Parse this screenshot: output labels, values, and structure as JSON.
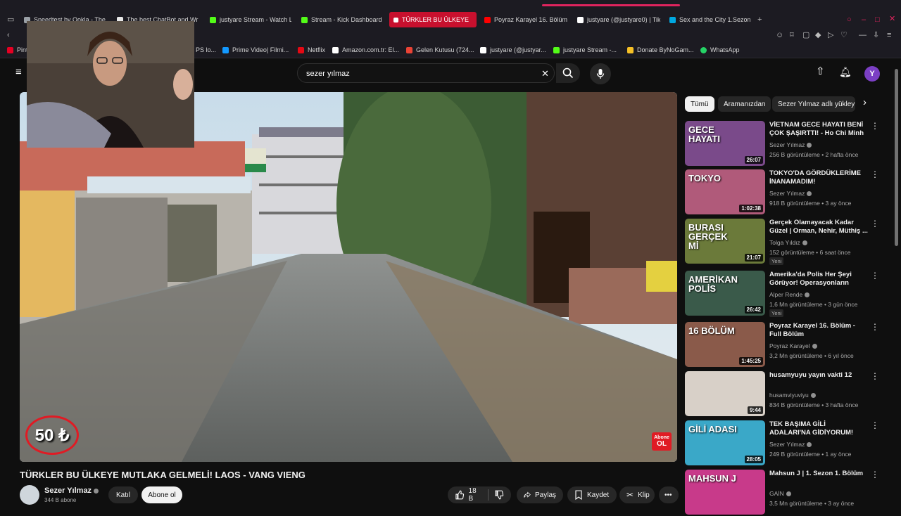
{
  "browser": {
    "tabs": [
      {
        "label": "Speedtest by Ookla - The",
        "color": "#9aa0a6"
      },
      {
        "label": "The best ChatBot and Wr",
        "color": "#e8e8e8"
      },
      {
        "label": "justyare Stream - Watch L",
        "color": "#53fc18"
      },
      {
        "label": "Stream - Kick Dashboard",
        "color": "#53fc18"
      },
      {
        "label": "TÜRKLER BU ÜLKEYE",
        "color": "#ff0000"
      },
      {
        "label": "Poyraz Karayel 16. Bölüm",
        "color": "#ff0000"
      },
      {
        "label": "justyare (@justyare0) | Tik",
        "color": "#ffffff"
      },
      {
        "label": "Sex and the City 1.Sezon",
        "color": "#00a8e1"
      }
    ],
    "bookmarks": [
      {
        "label": "Pint",
        "color": "#e60023"
      },
      {
        "label": "PS lo...",
        "color": "#0070d1"
      },
      {
        "label": "Prime Video| Filmi...",
        "color": "#1399ff"
      },
      {
        "label": "Netflix",
        "color": "#e50914"
      },
      {
        "label": "Amazon.com.tr: El...",
        "color": "#ffffff"
      },
      {
        "label": "Gelen Kutusu (724...",
        "color": "#ea4335"
      },
      {
        "label": "justyare (@justyar...",
        "color": "#ffffff"
      },
      {
        "label": "justyare Stream -...",
        "color": "#53fc18"
      },
      {
        "label": "Donate ByNoGam...",
        "color": "#f6c026"
      },
      {
        "label": "WhatsApp",
        "color": "#25d366"
      }
    ]
  },
  "youtube": {
    "search_value": "sezer yılmaz",
    "avatar_letter": "Y",
    "video_badge": "50 ₺",
    "abone_badge_top": "Abone",
    "abone_badge_bottom": "OL",
    "video_title": "TÜRKLER BU ÜLKEYE MUTLAKA GELMELİ! LAOS - VANG VIENG",
    "channel": "Sezer Yılmaz",
    "subscribers": "344 B abone",
    "join_label": "Katıl",
    "subscribe_label": "Abone ol",
    "likes": "18 B",
    "share_label": "Paylaş",
    "save_label": "Kaydet",
    "clip_label": "Klip",
    "chips": [
      "Tümü",
      "Aramanızdan",
      "Sezer Yılmaz adlı yükley"
    ],
    "related": [
      {
        "title": "VİETNAM GECE HAYATI BENİ ÇOK ŞAŞIRTTI! - Ho Chi Minh",
        "channel": "Sezer Yılmaz",
        "meta": "256 B görüntüleme • 2 hafta önce",
        "duration": "26:07",
        "color": "#7a4a8a",
        "overlay": "GECE HAYATI",
        "new": ""
      },
      {
        "title": "TOKYO'DA GÖRDÜKLERİME İNANAMADIM!",
        "channel": "Sezer Yılmaz",
        "meta": "918 B görüntüleme • 3 ay önce",
        "duration": "1:02:38",
        "color": "#b05a7a",
        "overlay": "TOKYO",
        "new": ""
      },
      {
        "title": "Gerçek Olamayacak Kadar Güzel | Orman, Nehir, Müthiş ...",
        "channel": "Tolga Yıldız",
        "meta": "152 görüntüleme • 6 saat önce",
        "duration": "21:07",
        "color": "#6b7a3a",
        "overlay": "BURASI GERÇEK Mİ",
        "new": "Yeni"
      },
      {
        "title": "Amerika'da Polis Her Şeyi Görüyor! Operasyonların Perde...",
        "channel": "Alper Rende",
        "meta": "1,6 Mn görüntüleme • 3 gün önce",
        "duration": "26:42",
        "color": "#3a5a4a",
        "overlay": "AMERİKAN POLİS",
        "new": "Yeni"
      },
      {
        "title": "Poyraz Karayel 16. Bölüm - Full Bölüm",
        "channel": "Poyraz Karayel",
        "meta": "3,2 Mn görüntüleme • 6 yıl önce",
        "duration": "1:45:25",
        "color": "#8a5a4a",
        "overlay": "16 BÖLÜM",
        "new": ""
      },
      {
        "title": "husamyuyu yayın vakti 12",
        "channel": "husamviyuviyu",
        "meta": "834 B görüntüleme • 3 hafta önce",
        "duration": "9:44",
        "color": "#d8d0c8",
        "overlay": "",
        "new": ""
      },
      {
        "title": "TEK BAŞIMA GİLİ ADALARI'NA GİDİYORUM!",
        "channel": "Sezer Yılmaz",
        "meta": "249 B görüntüleme • 1 ay önce",
        "duration": "28:05",
        "color": "#3aa8c8",
        "overlay": "GİLİ ADASI",
        "new": ""
      },
      {
        "title": "Mahsun J | 1. Sezon 1. Bölüm",
        "channel": "GAİN",
        "meta": "3,5 Mn görüntüleme • 3 ay önce",
        "duration": "",
        "color": "#c83a8a",
        "overlay": "MAHSUN J",
        "new": ""
      }
    ]
  },
  "colors": {
    "active_tab": "#c8102e",
    "avatar": "#7b3fc4",
    "badge_red": "#e01b24"
  }
}
